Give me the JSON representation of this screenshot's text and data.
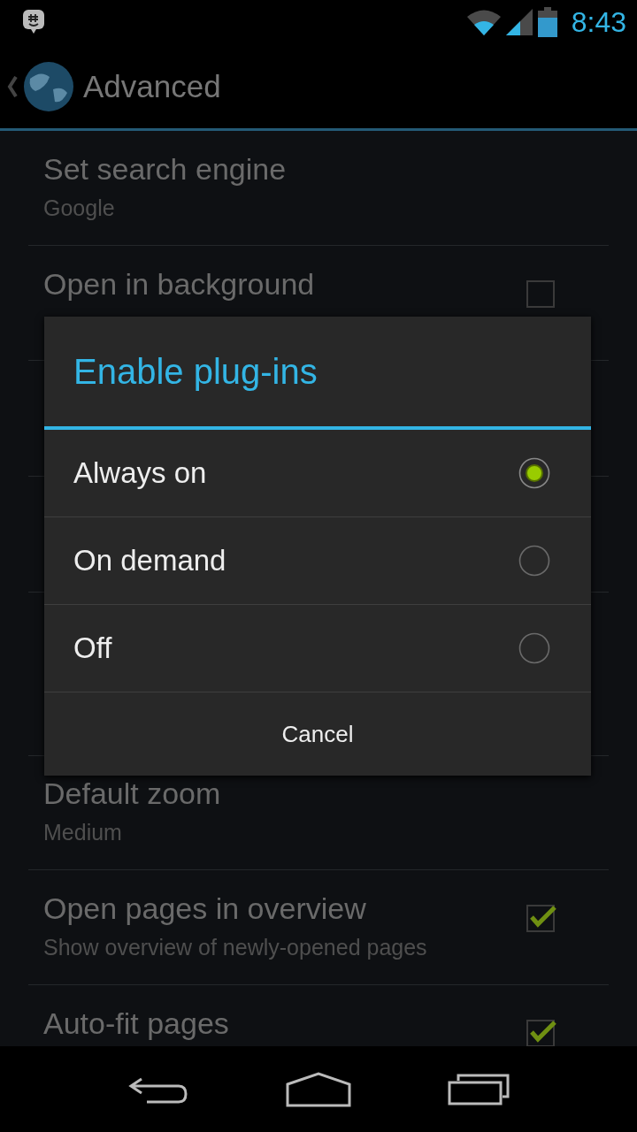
{
  "status_bar": {
    "time": "8:43"
  },
  "action_bar": {
    "title": "Advanced"
  },
  "settings_above": [
    {
      "kind": "list",
      "title": "Set search engine",
      "summary": "Google"
    },
    {
      "kind": "checkbox",
      "title": "Open in background",
      "checked": false
    }
  ],
  "settings_below": [
    {
      "kind": "list",
      "title": "Default zoom",
      "summary": "Medium"
    },
    {
      "kind": "checkbox",
      "title": "Open pages in overview",
      "summary": "Show overview of newly-opened pages",
      "checked": true
    },
    {
      "kind": "checkbox",
      "title": "Auto-fit pages",
      "checked": true
    }
  ],
  "dialog": {
    "title": "Enable plug-ins",
    "options": [
      {
        "label": "Always on",
        "selected": true
      },
      {
        "label": "On demand",
        "selected": false
      },
      {
        "label": "Off",
        "selected": false
      }
    ],
    "cancel": "Cancel"
  }
}
